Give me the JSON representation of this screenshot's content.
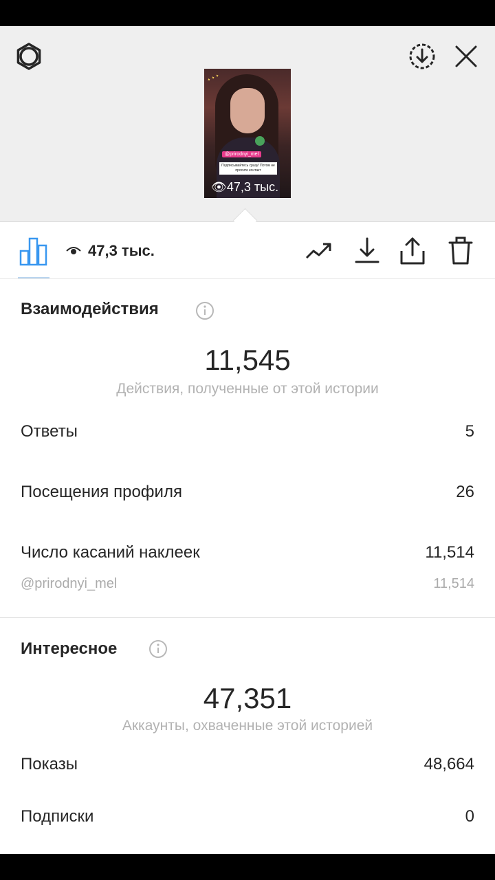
{
  "header": {
    "story_thumbnail": {
      "views_label": "47,3 тыс.",
      "mention": "@prirodnyi_mel",
      "sticker_text": "Подписывайтесь сразу! Потом не просите контакт"
    }
  },
  "toolbar": {
    "views_label": "47,3 тыс.",
    "icons": [
      "bar-chart-icon",
      "eye-icon",
      "trending-icon",
      "download-icon",
      "share-icon",
      "trash-icon"
    ]
  },
  "interactions": {
    "title": "Взаимодействия",
    "total": "11,545",
    "total_caption": "Действия, полученные от этой истории",
    "rows": [
      {
        "label": "Ответы",
        "value": "5"
      },
      {
        "label": "Посещения профиля",
        "value": "26"
      },
      {
        "label": "Число касаний наклеек",
        "value": "11,514"
      }
    ],
    "sticker_detail": {
      "label": "@prirodnyi_mel",
      "value": "11,514"
    }
  },
  "discovery": {
    "title": "Интересное",
    "total": "47,351",
    "total_caption": "Аккаунты, охваченные этой историей",
    "rows": [
      {
        "label": "Показы",
        "value": "48,664"
      },
      {
        "label": "Подписки",
        "value": "0"
      }
    ]
  },
  "colors": {
    "accent": "#3897f0",
    "muted_text": "#b2b2b2",
    "mention_bg": "#e83b8c"
  }
}
